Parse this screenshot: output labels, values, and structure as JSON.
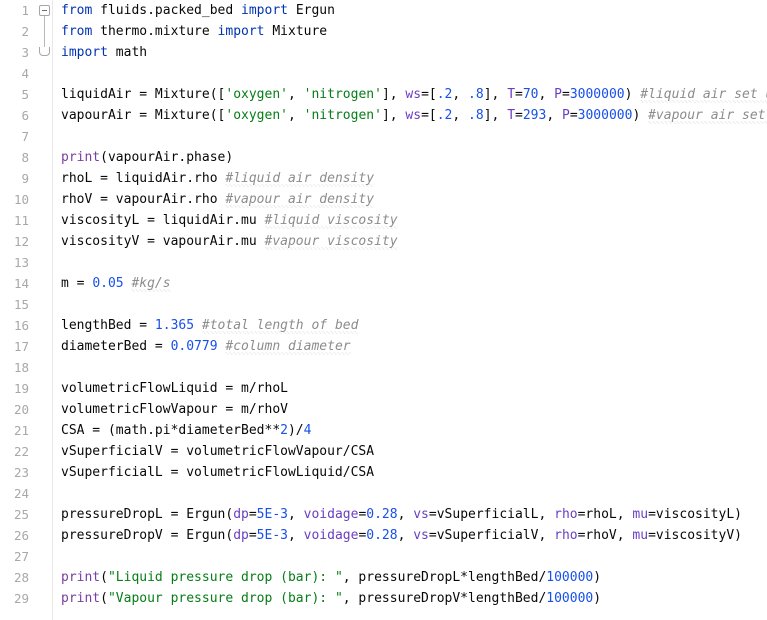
{
  "editor": {
    "language": "python",
    "theme": "light",
    "colors": {
      "background": "#ffffff",
      "gutter_background": "#ffffff",
      "gutter_separator": "#e8e8e8",
      "line_number": "#a8a8a8",
      "default_text": "#080808",
      "keyword": "#0033b3",
      "number": "#1750eb",
      "string": "#067d17",
      "builtin_function": "#7a3ea0",
      "named_argument": "#6a3ec2",
      "comment": "#8c8c8c",
      "squiggle": "#c9c9c9",
      "fold_marker": "#a6a6a6"
    },
    "first_visible_line": 1,
    "last_visible_line": 29
  },
  "fold_markers": [
    {
      "line": 1,
      "type": "collapse-box",
      "icon": "fold-collapse-icon"
    },
    {
      "line": 3,
      "type": "region-end",
      "icon": "fold-end-icon"
    }
  ],
  "line_numbers": [
    "1",
    "2",
    "3",
    "4",
    "5",
    "6",
    "7",
    "8",
    "9",
    "10",
    "11",
    "12",
    "13",
    "14",
    "15",
    "16",
    "17",
    "18",
    "19",
    "20",
    "21",
    "22",
    "23",
    "24",
    "25",
    "26",
    "27",
    "28",
    "29"
  ],
  "lines": [
    {
      "n": 1,
      "text": "from fluids.packed_bed import Ergun",
      "tokens": [
        {
          "t": "from ",
          "c": "kw"
        },
        {
          "t": "fluids.packed_bed ",
          "c": "plain"
        },
        {
          "t": "import ",
          "c": "kw"
        },
        {
          "t": "Ergun",
          "c": "plain"
        }
      ]
    },
    {
      "n": 2,
      "text": "from thermo.mixture import Mixture",
      "tokens": [
        {
          "t": "from ",
          "c": "kw"
        },
        {
          "t": "thermo.mixture ",
          "c": "plain"
        },
        {
          "t": "import ",
          "c": "kw"
        },
        {
          "t": "Mixture",
          "c": "plain"
        }
      ]
    },
    {
      "n": 3,
      "text": "import math",
      "tokens": [
        {
          "t": "import ",
          "c": "kw"
        },
        {
          "t": "math",
          "c": "plain"
        }
      ]
    },
    {
      "n": 4,
      "text": "",
      "tokens": []
    },
    {
      "n": 5,
      "text": "liquidAir = Mixture(['oxygen', 'nitrogen'], ws=[.2, .8], T=70, P=3000000) #liquid air set up",
      "tokens": [
        {
          "t": "liquidAir = Mixture([",
          "c": "plain"
        },
        {
          "t": "'oxygen'",
          "c": "str"
        },
        {
          "t": ", ",
          "c": "plain"
        },
        {
          "t": "'nitrogen'",
          "c": "str"
        },
        {
          "t": "], ",
          "c": "plain"
        },
        {
          "t": "ws",
          "c": "kwarg"
        },
        {
          "t": "=[",
          "c": "plain"
        },
        {
          "t": ".2",
          "c": "num"
        },
        {
          "t": ", ",
          "c": "plain"
        },
        {
          "t": ".8",
          "c": "num"
        },
        {
          "t": "], ",
          "c": "plain"
        },
        {
          "t": "T",
          "c": "kwarg"
        },
        {
          "t": "=",
          "c": "plain"
        },
        {
          "t": "70",
          "c": "num"
        },
        {
          "t": ", ",
          "c": "plain"
        },
        {
          "t": "P",
          "c": "kwarg"
        },
        {
          "t": "=",
          "c": "plain"
        },
        {
          "t": "3000000",
          "c": "num"
        },
        {
          "t": ") ",
          "c": "plain"
        },
        {
          "t": "#liquid air set up",
          "c": "cmt"
        }
      ]
    },
    {
      "n": 6,
      "text": "vapourAir = Mixture(['oxygen', 'nitrogen'], ws=[.2, .8], T=293, P=3000000) #vapour air set up",
      "tokens": [
        {
          "t": "vapourAir = Mixture([",
          "c": "plain"
        },
        {
          "t": "'oxygen'",
          "c": "str"
        },
        {
          "t": ", ",
          "c": "plain"
        },
        {
          "t": "'nitrogen'",
          "c": "str"
        },
        {
          "t": "], ",
          "c": "plain"
        },
        {
          "t": "ws",
          "c": "kwarg"
        },
        {
          "t": "=[",
          "c": "plain"
        },
        {
          "t": ".2",
          "c": "num"
        },
        {
          "t": ", ",
          "c": "plain"
        },
        {
          "t": ".8",
          "c": "num"
        },
        {
          "t": "], ",
          "c": "plain"
        },
        {
          "t": "T",
          "c": "kwarg"
        },
        {
          "t": "=",
          "c": "plain"
        },
        {
          "t": "293",
          "c": "num"
        },
        {
          "t": ", ",
          "c": "plain"
        },
        {
          "t": "P",
          "c": "kwarg"
        },
        {
          "t": "=",
          "c": "plain"
        },
        {
          "t": "3000000",
          "c": "num"
        },
        {
          "t": ") ",
          "c": "plain"
        },
        {
          "t": "#vapour air set up",
          "c": "cmt"
        }
      ]
    },
    {
      "n": 7,
      "text": "",
      "tokens": []
    },
    {
      "n": 8,
      "text": "print(vapourAir.phase)",
      "tokens": [
        {
          "t": "print",
          "c": "bif"
        },
        {
          "t": "(vapourAir.phase)",
          "c": "plain"
        }
      ]
    },
    {
      "n": 9,
      "text": "rhoL = liquidAir.rho #liquid air density",
      "tokens": [
        {
          "t": "rhoL = liquidAir.rho ",
          "c": "plain"
        },
        {
          "t": "#liquid air density",
          "c": "cmt"
        }
      ]
    },
    {
      "n": 10,
      "text": "rhoV = vapourAir.rho #vapour air density",
      "tokens": [
        {
          "t": "rhoV = vapourAir.rho ",
          "c": "plain"
        },
        {
          "t": "#vapour air density",
          "c": "cmt"
        }
      ]
    },
    {
      "n": 11,
      "text": "viscosityL = liquidAir.mu #liquid viscosity",
      "tokens": [
        {
          "t": "viscosityL = liquidAir.mu ",
          "c": "plain"
        },
        {
          "t": "#liquid viscosity",
          "c": "cmt"
        }
      ]
    },
    {
      "n": 12,
      "text": "viscosityV = vapourAir.mu #vapour viscosity",
      "tokens": [
        {
          "t": "viscosityV = vapourAir.mu ",
          "c": "plain"
        },
        {
          "t": "#vapour viscosity",
          "c": "cmt"
        }
      ]
    },
    {
      "n": 13,
      "text": "",
      "tokens": []
    },
    {
      "n": 14,
      "text": "m = 0.05 #kg/s",
      "tokens": [
        {
          "t": "m = ",
          "c": "plain"
        },
        {
          "t": "0.05",
          "c": "num"
        },
        {
          "t": " ",
          "c": "plain"
        },
        {
          "t": "#kg/s",
          "c": "cmt"
        }
      ]
    },
    {
      "n": 15,
      "text": "",
      "tokens": []
    },
    {
      "n": 16,
      "text": "lengthBed = 1.365 #total length of bed",
      "tokens": [
        {
          "t": "lengthBed = ",
          "c": "plain"
        },
        {
          "t": "1.365",
          "c": "num"
        },
        {
          "t": " ",
          "c": "plain"
        },
        {
          "t": "#total length of bed",
          "c": "cmt"
        }
      ]
    },
    {
      "n": 17,
      "text": "diameterBed = 0.0779 #column diameter",
      "tokens": [
        {
          "t": "diameterBed = ",
          "c": "plain"
        },
        {
          "t": "0.0779",
          "c": "num"
        },
        {
          "t": " ",
          "c": "plain"
        },
        {
          "t": "#column diameter",
          "c": "cmt"
        }
      ]
    },
    {
      "n": 18,
      "text": "",
      "tokens": []
    },
    {
      "n": 19,
      "text": "volumetricFlowLiquid = m/rhoL",
      "tokens": [
        {
          "t": "volumetricFlowLiquid = m/rhoL",
          "c": "plain"
        }
      ]
    },
    {
      "n": 20,
      "text": "volumetricFlowVapour = m/rhoV",
      "tokens": [
        {
          "t": "volumetricFlowVapour = m/rhoV",
          "c": "plain"
        }
      ]
    },
    {
      "n": 21,
      "text": "CSA = (math.pi*diameterBed**2)/4",
      "tokens": [
        {
          "t": "CSA = (math.pi*diameterBed**",
          "c": "plain"
        },
        {
          "t": "2",
          "c": "num"
        },
        {
          "t": ")/",
          "c": "plain"
        },
        {
          "t": "4",
          "c": "num"
        }
      ]
    },
    {
      "n": 22,
      "text": "vSuperficialV = volumetricFlowVapour/CSA",
      "tokens": [
        {
          "t": "vSuperficialV = volumetricFlowVapour/CSA",
          "c": "plain"
        }
      ]
    },
    {
      "n": 23,
      "text": "vSuperficialL = volumetricFlowLiquid/CSA",
      "tokens": [
        {
          "t": "vSuperficialL = volumetricFlowLiquid/CSA",
          "c": "plain"
        }
      ]
    },
    {
      "n": 24,
      "text": "",
      "tokens": []
    },
    {
      "n": 25,
      "text": "pressureDropL = Ergun(dp=5E-3, voidage=0.28, vs=vSuperficialL, rho=rhoL, mu=viscosityL)",
      "tokens": [
        {
          "t": "pressureDropL = Ergun(",
          "c": "plain"
        },
        {
          "t": "dp",
          "c": "kwarg"
        },
        {
          "t": "=",
          "c": "plain"
        },
        {
          "t": "5E-3",
          "c": "num"
        },
        {
          "t": ", ",
          "c": "plain"
        },
        {
          "t": "voidage",
          "c": "kwarg"
        },
        {
          "t": "=",
          "c": "plain"
        },
        {
          "t": "0.28",
          "c": "num"
        },
        {
          "t": ", ",
          "c": "plain"
        },
        {
          "t": "vs",
          "c": "kwarg"
        },
        {
          "t": "=vSuperficialL, ",
          "c": "plain"
        },
        {
          "t": "rho",
          "c": "kwarg"
        },
        {
          "t": "=rhoL, ",
          "c": "plain"
        },
        {
          "t": "mu",
          "c": "kwarg"
        },
        {
          "t": "=viscosityL)",
          "c": "plain"
        }
      ]
    },
    {
      "n": 26,
      "text": "pressureDropV = Ergun(dp=5E-3, voidage=0.28, vs=vSuperficialV, rho=rhoV, mu=viscosityV)",
      "tokens": [
        {
          "t": "pressureDropV = Ergun(",
          "c": "plain"
        },
        {
          "t": "dp",
          "c": "kwarg"
        },
        {
          "t": "=",
          "c": "plain"
        },
        {
          "t": "5E-3",
          "c": "num"
        },
        {
          "t": ", ",
          "c": "plain"
        },
        {
          "t": "voidage",
          "c": "kwarg"
        },
        {
          "t": "=",
          "c": "plain"
        },
        {
          "t": "0.28",
          "c": "num"
        },
        {
          "t": ", ",
          "c": "plain"
        },
        {
          "t": "vs",
          "c": "kwarg"
        },
        {
          "t": "=vSuperficialV, ",
          "c": "plain"
        },
        {
          "t": "rho",
          "c": "kwarg"
        },
        {
          "t": "=rhoV, ",
          "c": "plain"
        },
        {
          "t": "mu",
          "c": "kwarg"
        },
        {
          "t": "=viscosityV)",
          "c": "plain"
        }
      ]
    },
    {
      "n": 27,
      "text": "",
      "tokens": []
    },
    {
      "n": 28,
      "text": "print(\"Liquid pressure drop (bar): \", pressureDropL*lengthBed/100000)",
      "tokens": [
        {
          "t": "print",
          "c": "bif"
        },
        {
          "t": "(",
          "c": "plain"
        },
        {
          "t": "\"Liquid pressure drop (bar): \"",
          "c": "str"
        },
        {
          "t": ", pressureDropL*lengthBed/",
          "c": "plain"
        },
        {
          "t": "100000",
          "c": "num"
        },
        {
          "t": ")",
          "c": "plain"
        }
      ]
    },
    {
      "n": 29,
      "text": "print(\"Vapour pressure drop (bar): \", pressureDropV*lengthBed/100000)",
      "tokens": [
        {
          "t": "print",
          "c": "bif"
        },
        {
          "t": "(",
          "c": "plain"
        },
        {
          "t": "\"Vapour pressure drop (bar): \"",
          "c": "str"
        },
        {
          "t": ", pressureDropV*lengthBed/",
          "c": "plain"
        },
        {
          "t": "100000",
          "c": "num"
        },
        {
          "t": ")",
          "c": "plain"
        }
      ]
    }
  ]
}
